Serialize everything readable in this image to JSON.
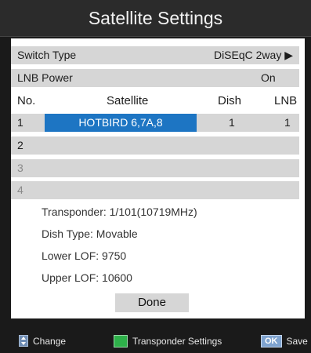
{
  "title": "Satellite Settings",
  "switch_type": {
    "label": "Switch Type",
    "value": "DiSEqC 2way",
    "arrow": "▶"
  },
  "lnb_power": {
    "label": "LNB Power",
    "value": "On"
  },
  "table": {
    "headers": {
      "no": "No.",
      "satellite": "Satellite",
      "dish": "Dish",
      "lnb": "LNB"
    },
    "rows": [
      {
        "no": "1",
        "satellite": "HOTBIRD 6,7A,8",
        "dish": "1",
        "lnb": "1"
      },
      {
        "no": "2",
        "satellite": "",
        "dish": "",
        "lnb": ""
      },
      {
        "no": "3",
        "satellite": "",
        "dish": "",
        "lnb": ""
      },
      {
        "no": "4",
        "satellite": "",
        "dish": "",
        "lnb": ""
      }
    ]
  },
  "info": {
    "transponder": "Transponder: 1/101(10719MHz)",
    "dish_type": "Dish Type: Movable",
    "lower_lof": "Lower LOF: 9750",
    "upper_lof": "Upper LOF: 10600"
  },
  "done_label": "Done",
  "footer": {
    "change": "Change",
    "transponder_settings": "Transponder Settings",
    "ok": "OK",
    "save": "Save"
  },
  "colors": {
    "selected": "#1d75c3",
    "green_key": "#2eb14a"
  }
}
